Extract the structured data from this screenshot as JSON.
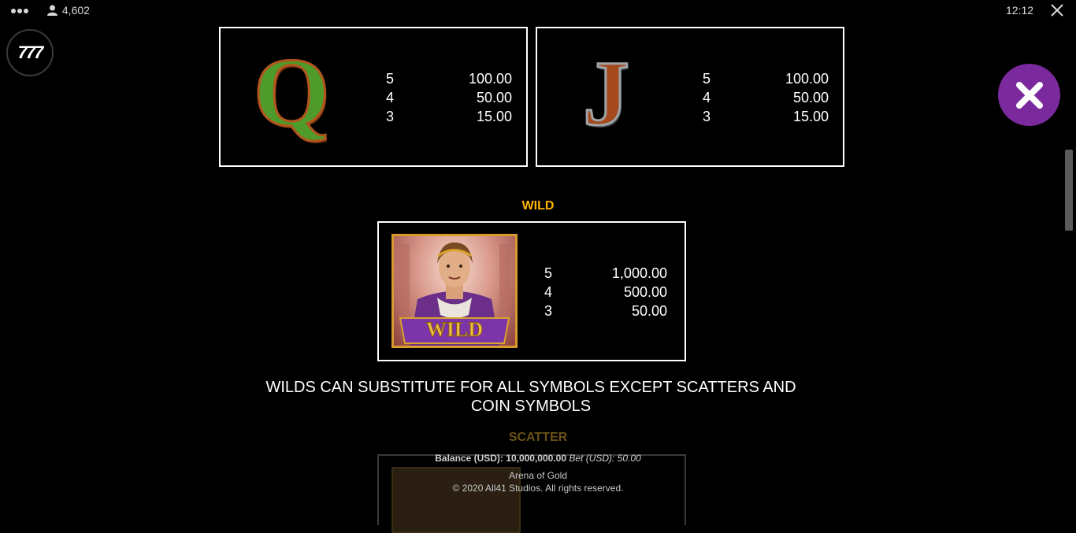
{
  "topbar": {
    "players_count": "4,602",
    "clock": "12:12"
  },
  "logo": {
    "text": "777"
  },
  "paytable": {
    "queen": {
      "symbol": "Q",
      "rows": [
        {
          "count": "5",
          "value": "100.00"
        },
        {
          "count": "4",
          "value": "50.00"
        },
        {
          "count": "3",
          "value": "15.00"
        }
      ]
    },
    "jack": {
      "symbol": "J",
      "rows": [
        {
          "count": "5",
          "value": "100.00"
        },
        {
          "count": "4",
          "value": "50.00"
        },
        {
          "count": "3",
          "value": "15.00"
        }
      ]
    },
    "wild": {
      "title": "WILD",
      "banner": "WILD",
      "rows": [
        {
          "count": "5",
          "value": "1,000.00"
        },
        {
          "count": "4",
          "value": "500.00"
        },
        {
          "count": "3",
          "value": "50.00"
        }
      ],
      "description_line1": "WILDS CAN SUBSTITUTE FOR ALL SYMBOLS EXCEPT SCATTERS AND",
      "description_line2": "COIN SYMBOLS"
    },
    "scatter": {
      "title": "SCATTER"
    }
  },
  "footer": {
    "balance_label": "Balance (USD):",
    "balance_value": "10,000,000.00",
    "bet_label": "Bet (USD):",
    "bet_value": "50.00",
    "game_name": "Arena of Gold",
    "copyright": "© 2020 All41 Studios. All rights reserved."
  },
  "colors": {
    "accent_gold": "#ffb400",
    "close_button": "#7a2a9c",
    "background": "#000000"
  },
  "icons": [
    "more-dots-icon",
    "user-icon",
    "close-icon",
    "close-circle-icon"
  ]
}
